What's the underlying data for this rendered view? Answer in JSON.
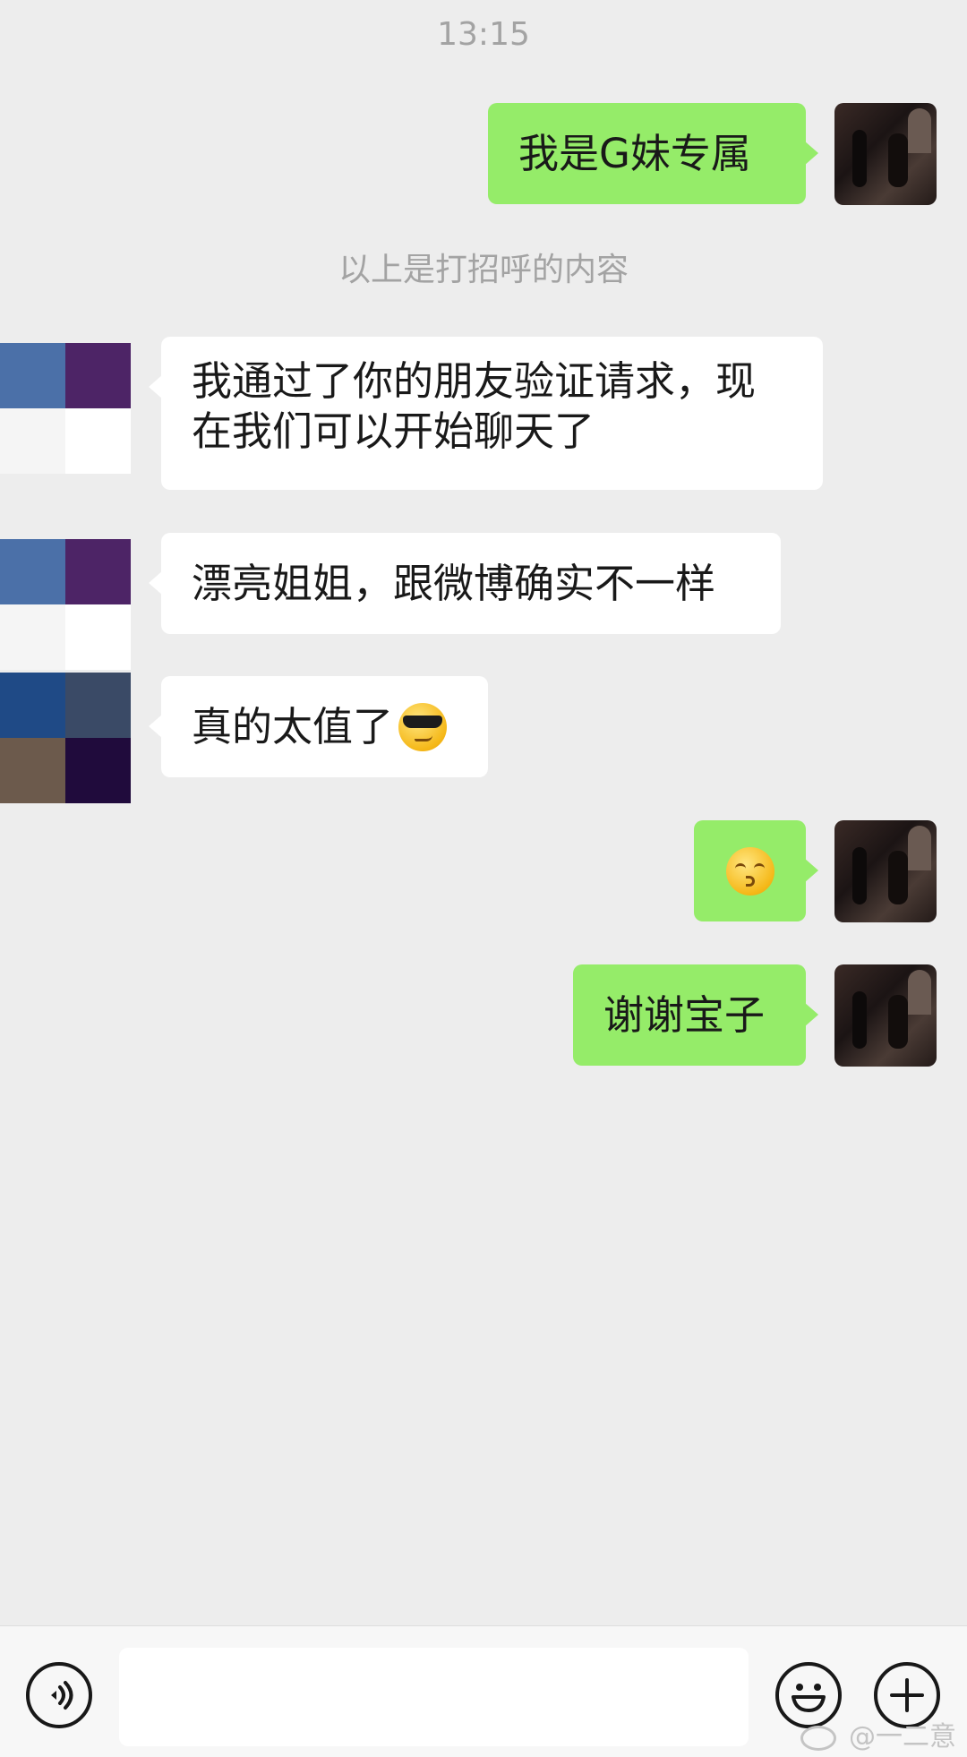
{
  "header": {
    "timestamp": "13:15"
  },
  "system_note": "以上是打招呼的内容",
  "messages": [
    {
      "from": "me",
      "text": "我是G妹专属"
    },
    {
      "from": "them",
      "text": "我通过了你的朋友验证请求，现在我们可以开始聊天了",
      "line1": "我通过了你的朋友验证请求，现",
      "line2": "在我们可以开始聊天了"
    },
    {
      "from": "them",
      "text": "漂亮姐姐，跟微博确实不一样"
    },
    {
      "from": "them",
      "text": "真的太值了",
      "emoji": "smiling-face-with-sunglasses"
    },
    {
      "from": "me",
      "text": "",
      "emoji": "kissing-face-with-smiling-eyes"
    },
    {
      "from": "me",
      "text": "谢谢宝子"
    }
  ],
  "input_bar": {
    "voice_icon": "voice-icon",
    "input_value": "",
    "emoji_icon": "emoji-icon",
    "plus_icon": "plus-icon"
  },
  "watermark": {
    "text": "@一二意",
    "icon": "weibo-icon"
  },
  "colors": {
    "background": "#ededed",
    "my_bubble": "#95ec69",
    "their_bubble": "#ffffff",
    "muted_text": "#a3a3a3"
  }
}
